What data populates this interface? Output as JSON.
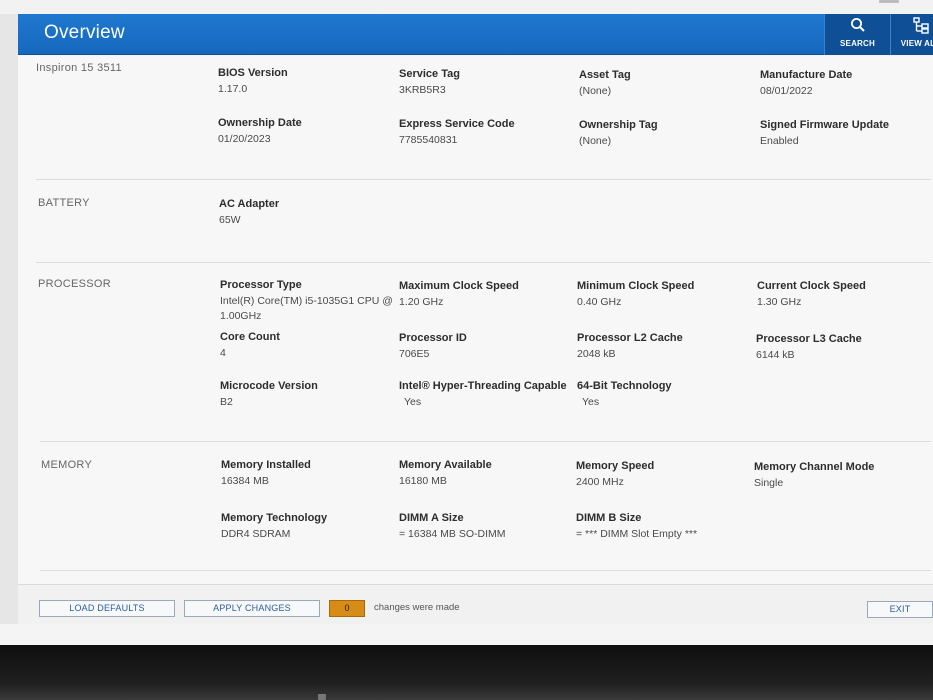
{
  "header": {
    "title": "Overview",
    "search_label": "SEARCH",
    "viewall_label": "VIEW ALL"
  },
  "system": {
    "model": "Inspiron 15 3511",
    "fields": [
      {
        "key": "BIOS Version",
        "value": "1.17.0"
      },
      {
        "key": "Service Tag",
        "value": "3KRB5R3"
      },
      {
        "key": "Asset Tag",
        "value": "(None)"
      },
      {
        "key": "Manufacture Date",
        "value": "08/01/2022"
      },
      {
        "key": "Ownership Date",
        "value": "01/20/2023"
      },
      {
        "key": "Express Service Code",
        "value": "7785540831"
      },
      {
        "key": "Ownership Tag",
        "value": "(None)"
      },
      {
        "key": "Signed Firmware Update",
        "value": "Enabled"
      }
    ]
  },
  "battery": {
    "label": "BATTERY",
    "fields": [
      {
        "key": "AC Adapter",
        "value": "65W"
      }
    ]
  },
  "processor": {
    "label": "PROCESSOR",
    "fields": [
      {
        "key": "Processor Type",
        "value": "Intel(R) Core(TM) i5-1035G1 CPU @ 1.00GHz"
      },
      {
        "key": "Maximum Clock Speed",
        "value": "1.20 GHz"
      },
      {
        "key": "Minimum Clock Speed",
        "value": "0.40 GHz"
      },
      {
        "key": "Current Clock Speed",
        "value": "1.30 GHz"
      },
      {
        "key": "Core Count",
        "value": "4"
      },
      {
        "key": "Processor ID",
        "value": "706E5"
      },
      {
        "key": "Processor L2 Cache",
        "value": "2048 kB"
      },
      {
        "key": "Processor L3 Cache",
        "value": "6144 kB"
      },
      {
        "key": "Microcode Version",
        "value": "B2"
      },
      {
        "key": "Intel® Hyper-Threading Capable",
        "value": "Yes"
      },
      {
        "key": "64-Bit Technology",
        "value": "Yes"
      }
    ]
  },
  "memory": {
    "label": "MEMORY",
    "fields": [
      {
        "key": "Memory Installed",
        "value": "16384 MB"
      },
      {
        "key": "Memory Available",
        "value": "16180 MB"
      },
      {
        "key": "Memory Speed",
        "value": "2400 MHz"
      },
      {
        "key": "Memory Channel Mode",
        "value": "Single"
      },
      {
        "key": "Memory Technology",
        "value": "DDR4 SDRAM"
      },
      {
        "key": "DIMM A Size",
        "value": "= 16384 MB SO-DIMM"
      },
      {
        "key": "DIMM B Size",
        "value": "= *** DIMM Slot Empty ***"
      }
    ]
  },
  "footer": {
    "load_defaults": "LOAD DEFAULTS",
    "apply_changes": "APPLY CHANGES",
    "change_count": "0",
    "changes_text": "changes were made",
    "exit": "EXIT"
  },
  "colors": {
    "header_blue": "#1a6fc6",
    "header_button": "#0e4f96",
    "counter_orange": "#d68c16"
  }
}
